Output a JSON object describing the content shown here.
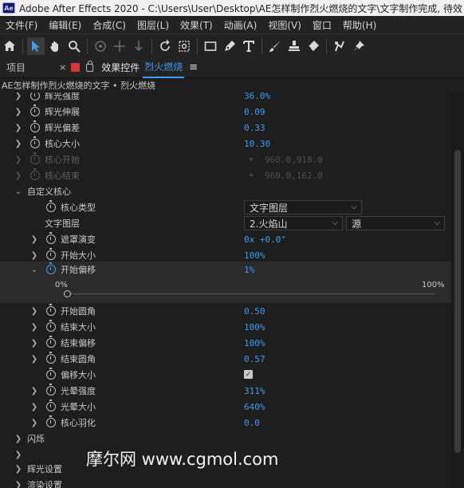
{
  "titlebar": {
    "app_icon": "Ae",
    "title": "Adobe After Effects 2020 - C:\\Users\\User\\Desktop\\AE怎样制作烈火燃烧的文字\\文字制作完成, 待效"
  },
  "menu": [
    "文件(F)",
    "编辑(E)",
    "合成(C)",
    "图层(L)",
    "效果(T)",
    "动画(A)",
    "视图(V)",
    "窗口",
    "帮助(H)"
  ],
  "toolbar": {
    "icons": [
      "home-icon",
      "selection-tool-icon",
      "hand-tool-icon",
      "zoom-tool-icon",
      "orbit-tool-icon",
      "pan-tool-icon",
      "dolly-tool-icon",
      "rotate-tool-icon",
      "camera-tool-icon",
      "rectangle-tool-icon",
      "pen-tool-icon",
      "type-tool-icon",
      "brush-tool-icon",
      "clone-stamp-icon",
      "eraser-icon",
      "roto-brush-icon",
      "puppet-pin-icon"
    ]
  },
  "panel": {
    "project_tab": "项目",
    "close_glyph": "×",
    "effects_tab": "效果控件",
    "layer_name": "烈火燃烧",
    "menu_glyph": "≡",
    "breadcrumb": "AE怎样制作烈火燃烧的文字 • 烈火燃烧"
  },
  "rows": [
    {
      "label": "辉光强度",
      "value": "36.0%"
    },
    {
      "label": "辉光伸展",
      "value": "0.09"
    },
    {
      "label": "辉光偏差",
      "value": "0.33"
    },
    {
      "label": "核心大小",
      "value": "10.30"
    },
    {
      "label": "核心开始",
      "value": "960.0,918.0",
      "disabled": true
    },
    {
      "label": "核心结束",
      "value": "960.0,162.0",
      "disabled": true
    }
  ],
  "custom_core": {
    "group_label": "自定义核心",
    "core_type_label": "核心类型",
    "core_type_value": "文字图层",
    "text_layer_label": "文字图层",
    "text_layer_value": "2.火焰山",
    "text_layer_source": "源",
    "mask_label": "遮罩演变",
    "mask_value": "0x +0.0°",
    "start_size_label": "开始大小",
    "start_size_value": "100%",
    "start_offset_label": "开始偏移",
    "start_offset_value": "1%",
    "slider_min": "0%",
    "slider_max": "100%",
    "slider_value": 0.01,
    "start_roundness_label": "开始圆角",
    "start_roundness_value": "0.50",
    "end_size_label": "结束大小",
    "end_size_value": "100%",
    "end_offset_label": "结束偏移",
    "end_offset_value": "100%",
    "end_roundness_label": "结束圆角",
    "end_roundness_value": "0.57",
    "offset_size_label": "偏移大小",
    "offset_size_checked": "✓",
    "halo_strength_label": "光晕强度",
    "halo_strength_value": "311%",
    "halo_size_label": "光晕大小",
    "halo_size_value": "640%",
    "core_feather_label": "核心羽化",
    "core_feather_value": "0.0"
  },
  "groups": {
    "flicker": "闪烁",
    "g2": "",
    "glow_settings": "辉光设置",
    "render_settings": "渲染设置"
  },
  "watermark": "摩尔网 www.cgmol.com",
  "colors": {
    "accent": "#3f9cf0",
    "label_color": "#ed1c24"
  }
}
